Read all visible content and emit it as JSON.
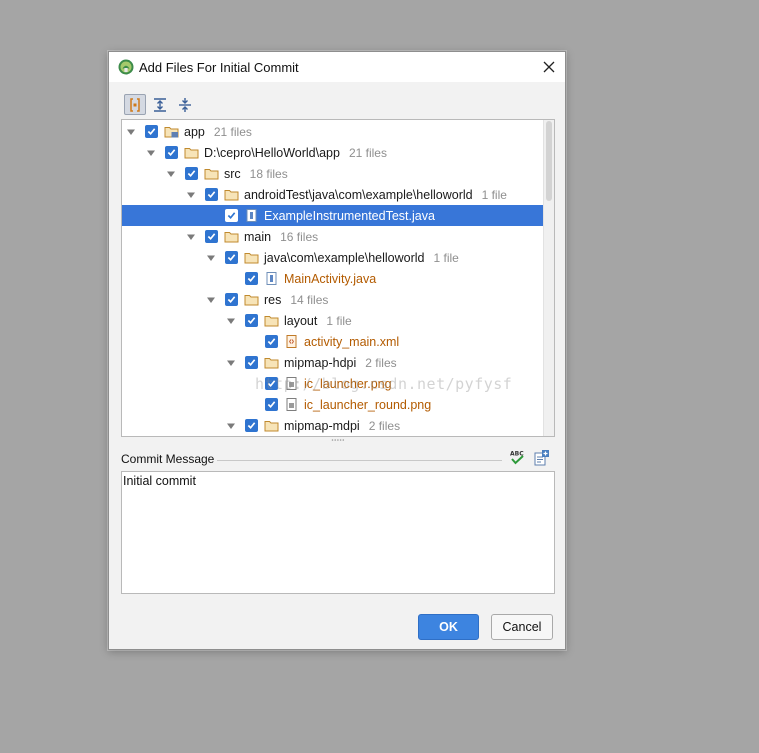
{
  "dialog": {
    "title": "Add Files For Initial Commit",
    "icons": {
      "app": "android-studio-icon",
      "close": "close-icon"
    }
  },
  "toolbar": {
    "buttons": [
      {
        "icon": "group-by-directory-icon",
        "active": true
      },
      {
        "icon": "expand-all-icon",
        "active": false
      },
      {
        "icon": "collapse-all-icon",
        "active": false
      }
    ]
  },
  "tree": {
    "rows": [
      {
        "name": "app",
        "count": "21 files",
        "type": "module",
        "depth": 0,
        "expanded": true,
        "checked": true,
        "selected": false
      },
      {
        "name": "D:\\cepro\\HelloWorld\\app",
        "count": "21 files",
        "type": "folder",
        "depth": 1,
        "expanded": true,
        "checked": true,
        "selected": false
      },
      {
        "name": "src",
        "count": "18 files",
        "type": "folder",
        "depth": 2,
        "expanded": true,
        "checked": true,
        "selected": false
      },
      {
        "name": "androidTest\\java\\com\\example\\helloworld",
        "count": "1 file",
        "type": "folder",
        "depth": 3,
        "expanded": true,
        "checked": true,
        "selected": false
      },
      {
        "name": "ExampleInstrumentedTest.java",
        "count": "",
        "type": "java",
        "depth": 4,
        "expanded": null,
        "checked": true,
        "selected": true
      },
      {
        "name": "main",
        "count": "16 files",
        "type": "folder",
        "depth": 3,
        "expanded": true,
        "checked": true,
        "selected": false
      },
      {
        "name": "java\\com\\example\\helloworld",
        "count": "1 file",
        "type": "folder",
        "depth": 4,
        "expanded": true,
        "checked": true,
        "selected": false
      },
      {
        "name": "MainActivity.java",
        "count": "",
        "type": "java",
        "depth": 5,
        "expanded": null,
        "checked": true,
        "selected": false
      },
      {
        "name": "res",
        "count": "14 files",
        "type": "folder",
        "depth": 4,
        "expanded": true,
        "checked": true,
        "selected": false
      },
      {
        "name": "layout",
        "count": "1 file",
        "type": "folder",
        "depth": 5,
        "expanded": true,
        "checked": true,
        "selected": false
      },
      {
        "name": "activity_main.xml",
        "count": "",
        "type": "xml",
        "depth": 6,
        "expanded": null,
        "checked": true,
        "selected": false
      },
      {
        "name": "mipmap-hdpi",
        "count": "2 files",
        "type": "folder",
        "depth": 5,
        "expanded": true,
        "checked": true,
        "selected": false
      },
      {
        "name": "ic_launcher.png",
        "count": "",
        "type": "image",
        "depth": 6,
        "expanded": null,
        "checked": true,
        "selected": false
      },
      {
        "name": "ic_launcher_round.png",
        "count": "",
        "type": "image",
        "depth": 6,
        "expanded": null,
        "checked": true,
        "selected": false
      },
      {
        "name": "mipmap-mdpi",
        "count": "2 files",
        "type": "folder",
        "depth": 5,
        "expanded": true,
        "checked": true,
        "selected": false
      }
    ]
  },
  "commit": {
    "label": "Commit Message",
    "value": "Initial commit",
    "icons": {
      "spellcheck": "spellcheck-icon",
      "history": "commit-history-icon"
    }
  },
  "buttons": {
    "ok": "OK",
    "cancel": "Cancel"
  },
  "watermark": "http://blog.csdn.net/pyfysf",
  "colors": {
    "selection": "#3876d8",
    "checkbox": "#2f74d0",
    "primary_button": "#3d84e0",
    "file_text": "#b35b00",
    "count_text": "#8f8f8f"
  }
}
